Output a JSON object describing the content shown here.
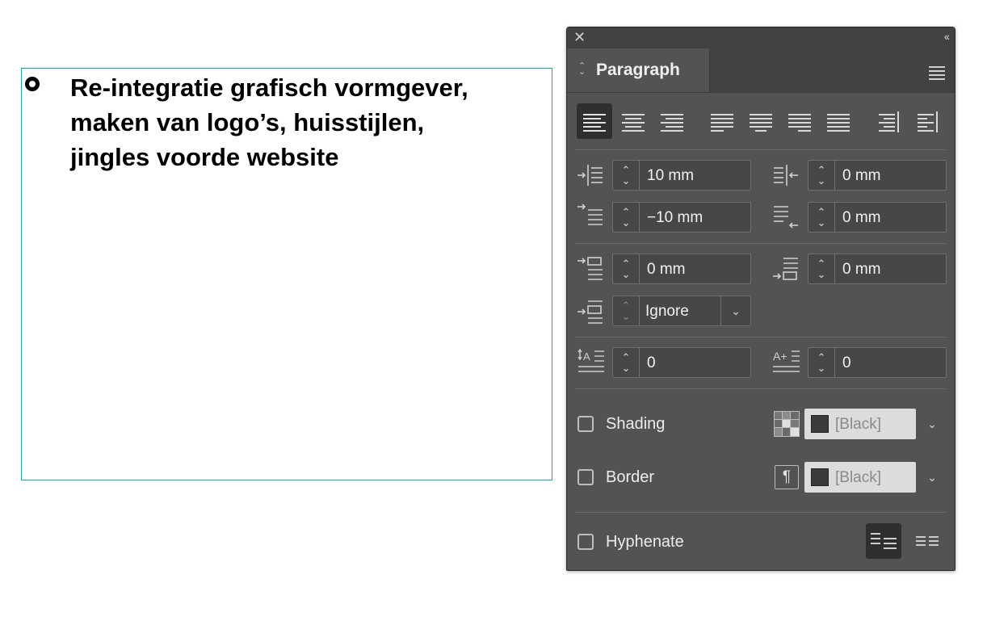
{
  "document": {
    "lines": [
      "Re-integratie grafisch vormgever,",
      "maken van logo’s, huisstijlen,",
      "jingles voorde website"
    ]
  },
  "panel": {
    "title": "Paragraph",
    "left_indent": "10 mm",
    "right_indent": "0 mm",
    "first_line_indent": "−10 mm",
    "last_line_right_indent": "0 mm",
    "space_before": "0 mm",
    "space_after": "0 mm",
    "align_to_grid": "Ignore",
    "drop_cap_lines": "0",
    "drop_cap_chars": "0",
    "shading_label": "Shading",
    "shading_color": "[Black]",
    "border_label": "Border",
    "border_color": "[Black]",
    "hyphenate_label": "Hyphenate"
  },
  "colors": {
    "panel_bg": "#535353",
    "frame_border": "#1fa3b3"
  }
}
